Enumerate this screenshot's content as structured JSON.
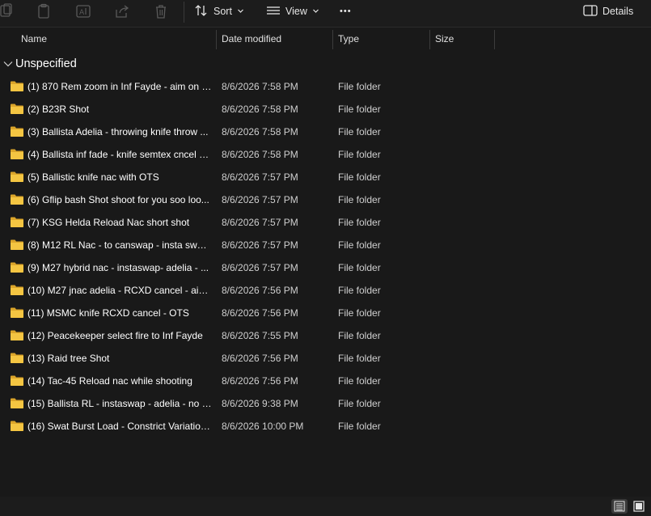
{
  "toolbar": {
    "sort_label": "Sort",
    "view_label": "View",
    "more_label": "•••",
    "details_label": "Details",
    "icons": [
      "new-item-icon",
      "paste-icon",
      "rename-icon",
      "share-icon",
      "delete-icon",
      "sort-icon",
      "view-icon",
      "details-pane-icon"
    ]
  },
  "columns": {
    "name": "Name",
    "date": "Date modified",
    "type": "Type",
    "size": "Size"
  },
  "group": {
    "label": "Unspecified"
  },
  "rows": [
    {
      "name": "(1) 870 Rem zoom in Inf Fayde - aim on n...",
      "date": "8/6/2026 7:58 PM",
      "type": "File folder"
    },
    {
      "name": "(2) B23R Shot",
      "date": "8/6/2026 7:58 PM",
      "type": "File folder"
    },
    {
      "name": "(3) Ballista Adelia - throwing knife throw ...",
      "date": "8/6/2026 7:58 PM",
      "type": "File folder"
    },
    {
      "name": "(4) Ballista inf fade - knife semtex cncel - ...",
      "date": "8/6/2026 7:58 PM",
      "type": "File folder"
    },
    {
      "name": "(5) Ballistic knife nac with OTS",
      "date": "8/6/2026 7:57 PM",
      "type": "File folder"
    },
    {
      "name": "(6) Gflip bash Shot shoot for you soo loo...",
      "date": "8/6/2026 7:57 PM",
      "type": "File folder"
    },
    {
      "name": "(7) KSG Helda Reload Nac short shot",
      "date": "8/6/2026 7:57 PM",
      "type": "File folder"
    },
    {
      "name": "(8) M12 RL Nac - to canswap - insta swap...",
      "date": "8/6/2026 7:57 PM",
      "type": "File folder"
    },
    {
      "name": "(9) M27 hybrid nac - instaswap- adelia - ...",
      "date": "8/6/2026 7:57 PM",
      "type": "File folder"
    },
    {
      "name": "(10) M27 jnac adelia - RCXD cancel - aim ...",
      "date": "8/6/2026 7:56 PM",
      "type": "File folder"
    },
    {
      "name": "(11) MSMC knife RCXD cancel - OTS",
      "date": "8/6/2026 7:56 PM",
      "type": "File folder"
    },
    {
      "name": "(12) Peacekeeper select fire to Inf Fayde",
      "date": "8/6/2026 7:55 PM",
      "type": "File folder"
    },
    {
      "name": "(13) Raid tree Shot",
      "date": "8/6/2026 7:56 PM",
      "type": "File folder"
    },
    {
      "name": "(14) Tac-45 Reload nac while shooting",
      "date": "8/6/2026 7:56 PM",
      "type": "File folder"
    },
    {
      "name": "(15) Ballista RL - instaswap - adelia - no s...",
      "date": "8/6/2026 9:38 PM",
      "type": "File folder"
    },
    {
      "name": "(16) Swat Burst Load - Constrict Variation...",
      "date": "8/6/2026 10:00 PM",
      "type": "File folder"
    }
  ],
  "statusbar": {
    "icons": [
      "details-view-icon",
      "tiles-view-icon"
    ]
  },
  "colors": {
    "background": "#191919",
    "folder": "#f4c542",
    "text": "#ffffff",
    "secondary_text": "#cfcfcf"
  }
}
